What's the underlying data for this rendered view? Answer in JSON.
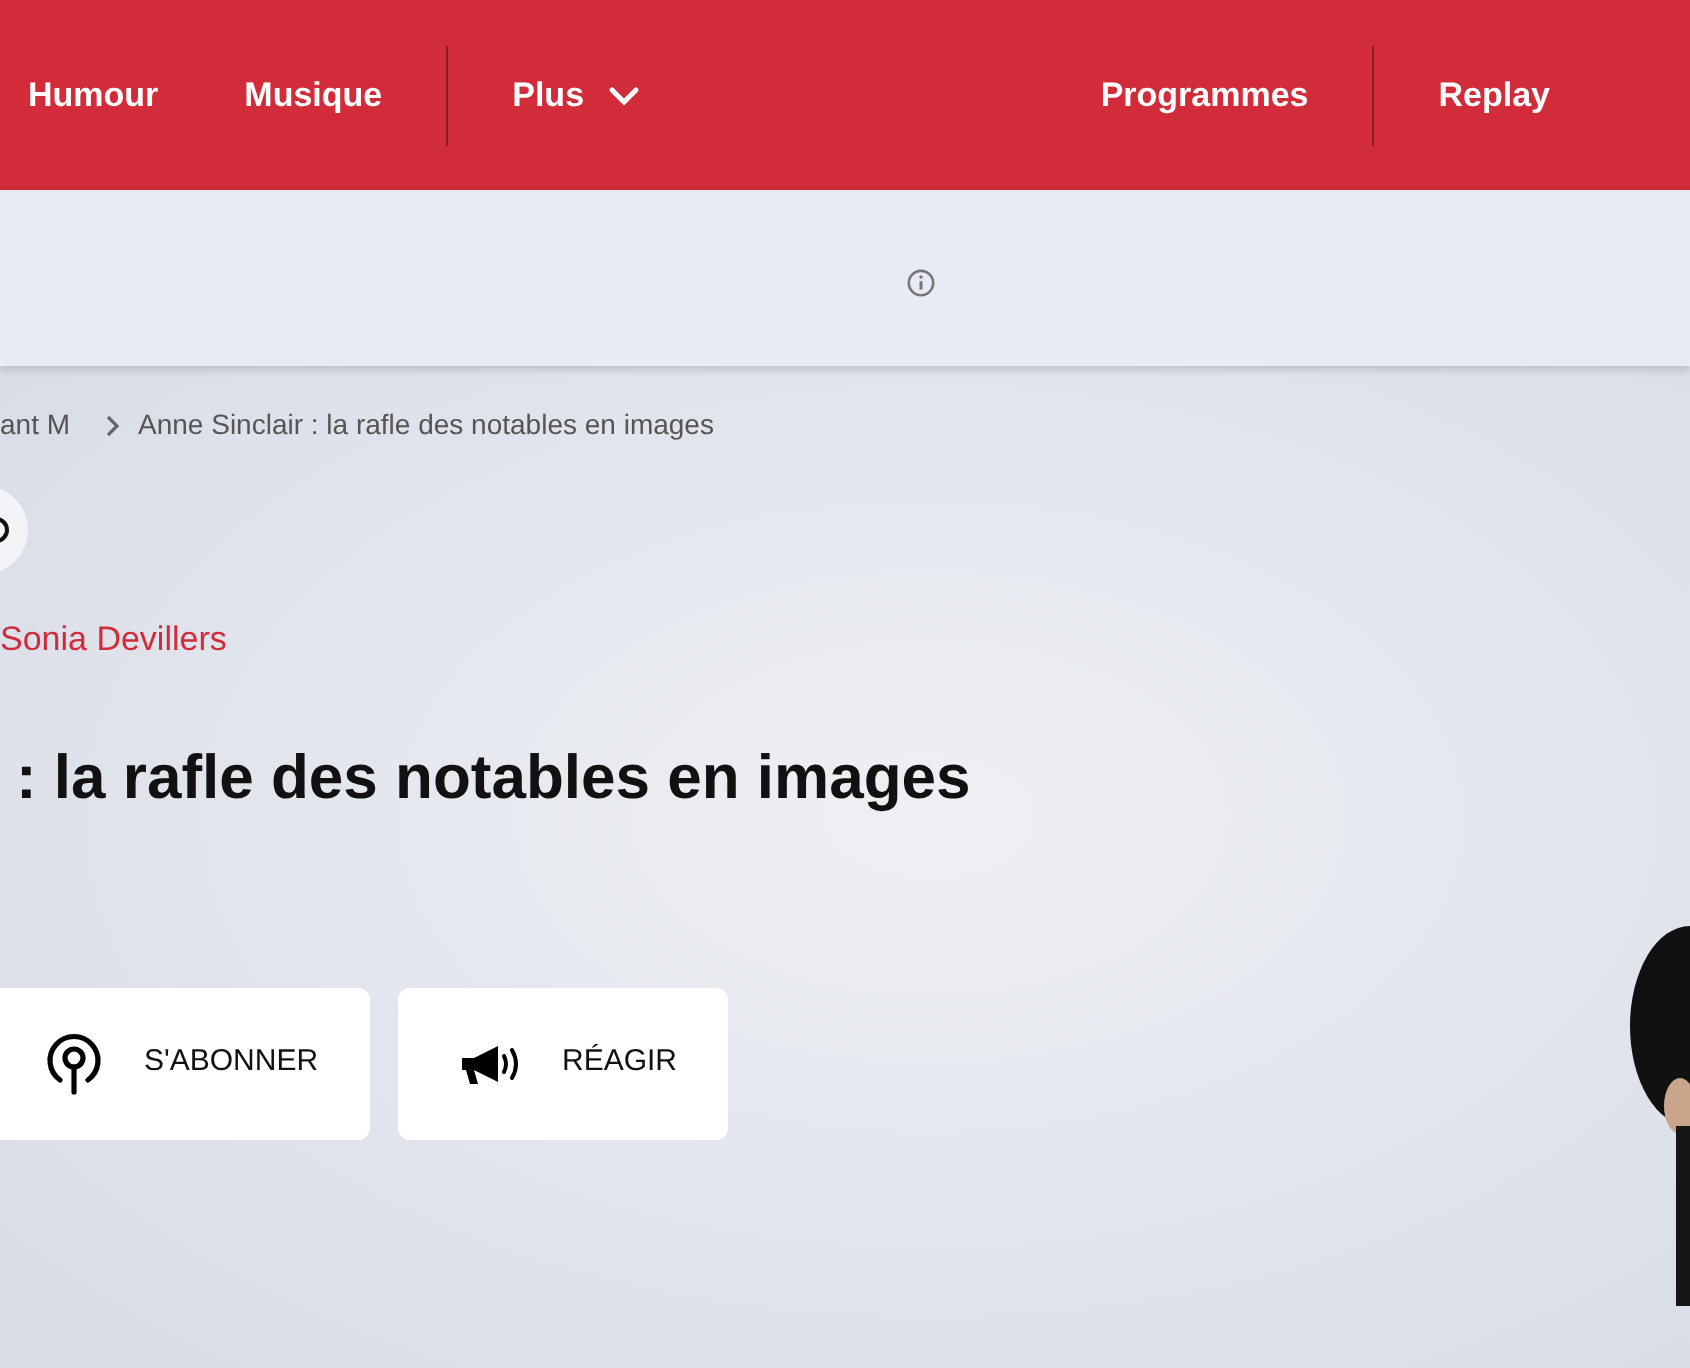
{
  "nav": {
    "groups": [
      [
        {
          "label": "Humour"
        },
        {
          "label": "Musique"
        }
      ],
      [
        {
          "label": "Plus",
          "kind": "dropdown"
        }
      ]
    ],
    "right_groups": [
      [
        {
          "label": "Programmes"
        }
      ],
      [
        {
          "label": "Replay"
        }
      ]
    ]
  },
  "breadcrumb": [
    "ant M",
    "Anne Sinclair : la rafle des notables en images"
  ],
  "author": "Sonia Devillers",
  "title": ": la rafle des notables en images",
  "actions": [
    {
      "label": "S'ABONNER",
      "kind": "podcast"
    },
    {
      "label": "RÉAGIR",
      "kind": "megaphone"
    }
  ]
}
